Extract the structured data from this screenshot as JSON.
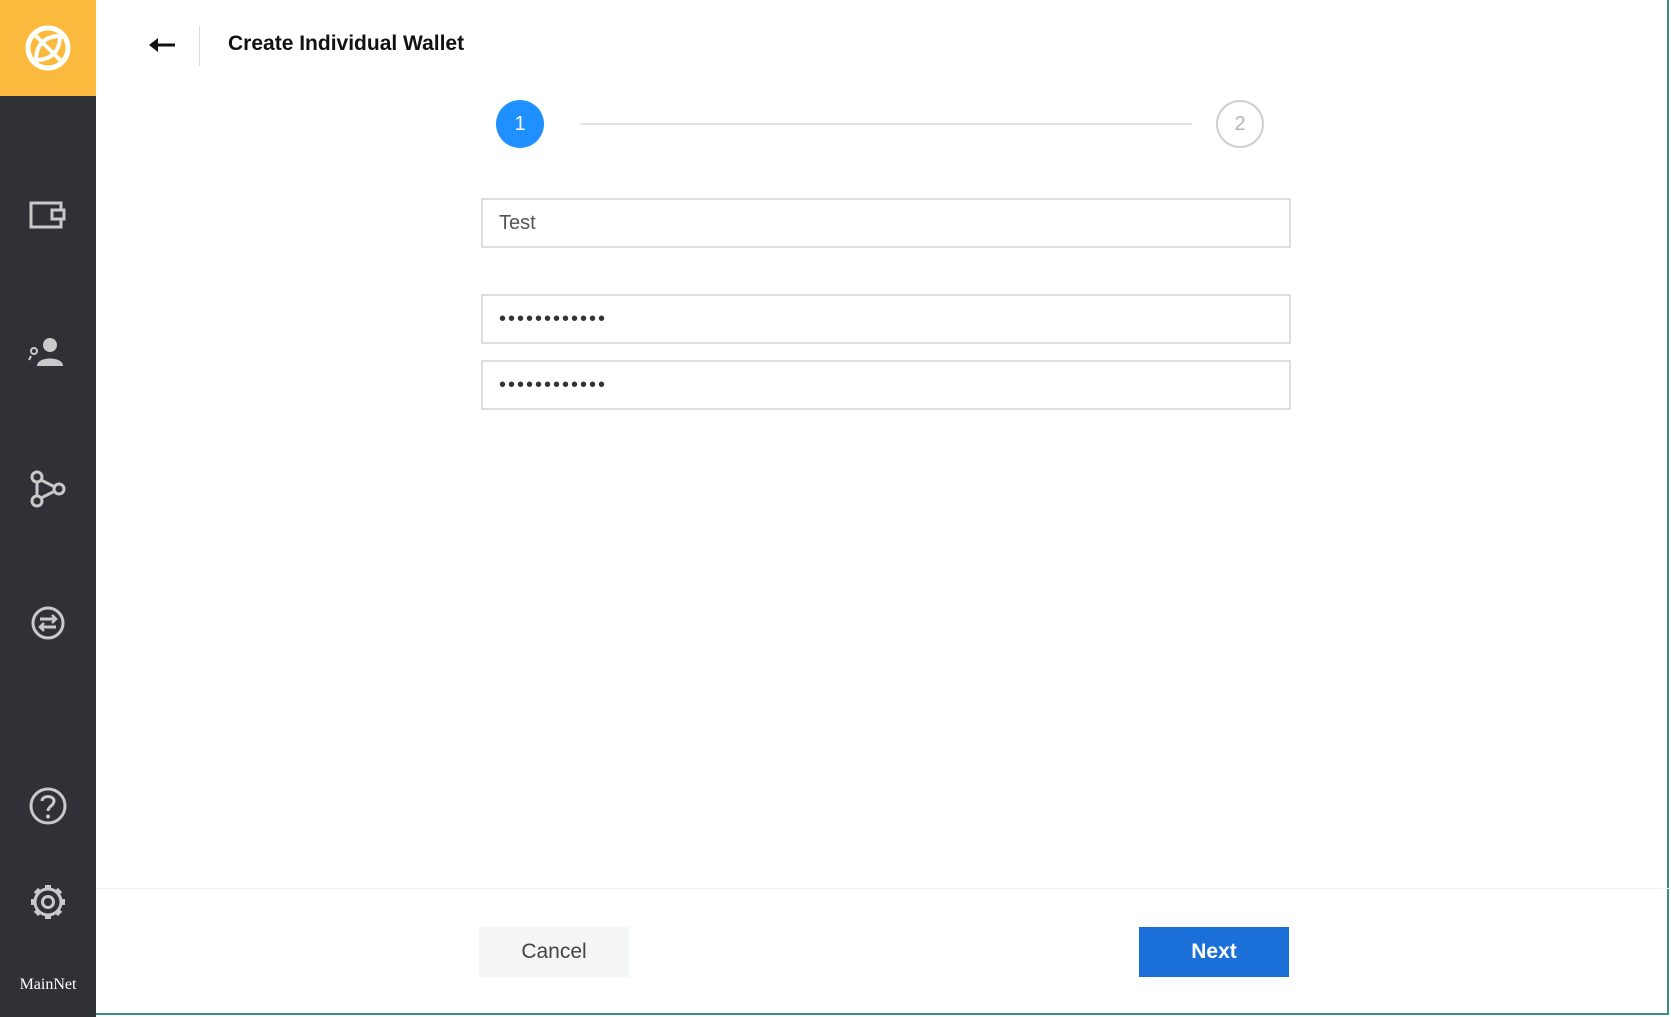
{
  "sidebar": {
    "logo": {
      "icon": "leaf-slash-logo-icon",
      "bg_color": "#fbb93e"
    },
    "items": [
      {
        "icon": "wallet-icon"
      },
      {
        "icon": "contacts-icon"
      },
      {
        "icon": "network-nodes-icon"
      },
      {
        "icon": "exchange-icon"
      },
      {
        "icon": "help-icon"
      },
      {
        "icon": "gear-icon"
      }
    ],
    "network_label": "MainNet"
  },
  "header": {
    "back_icon": "arrow-left-icon",
    "title": "Create Individual Wallet"
  },
  "stepper": {
    "steps": [
      {
        "label": "1",
        "state": "active"
      },
      {
        "label": "2",
        "state": "inactive"
      }
    ],
    "active_color": "#1e90ff"
  },
  "form": {
    "wallet_name_value": "Test",
    "password_value": "••••••••••••",
    "confirm_password_value": "••••••••••••"
  },
  "footer": {
    "cancel_label": "Cancel",
    "next_label": "Next",
    "next_color": "#1b6fd9"
  }
}
